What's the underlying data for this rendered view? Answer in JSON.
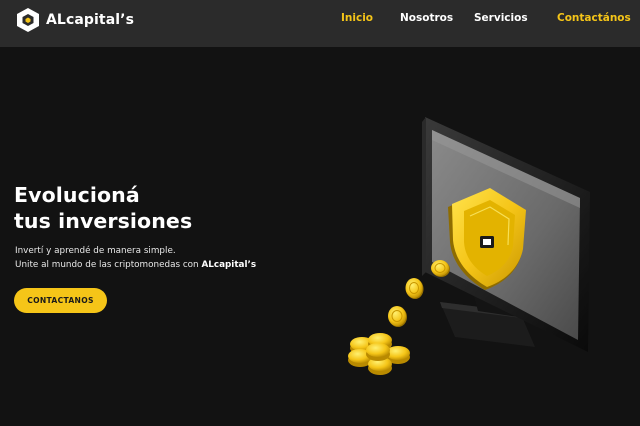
{
  "brand": {
    "name": "ALcapital’s",
    "accent_color": "#f5c518"
  },
  "nav": {
    "items": [
      {
        "label": "Inicio",
        "active": true
      },
      {
        "label": "Nosotros",
        "active": false
      },
      {
        "label": "Servicios",
        "active": false
      }
    ],
    "contact_label": "Contactános"
  },
  "hero": {
    "title_line1": "Evolucioná",
    "title_line2": "tus inversiones",
    "desc_line1": "Invertí y aprendé de manera simple.",
    "desc_line2_prefix": "Unite al mundo de las criptomonedas con",
    "desc_line2_brand": "ALcapital’s",
    "cta_label": "CONTACTANOS"
  },
  "illustration": {
    "icons": [
      "monitor-icon",
      "shield-icon",
      "coin-icon"
    ]
  }
}
